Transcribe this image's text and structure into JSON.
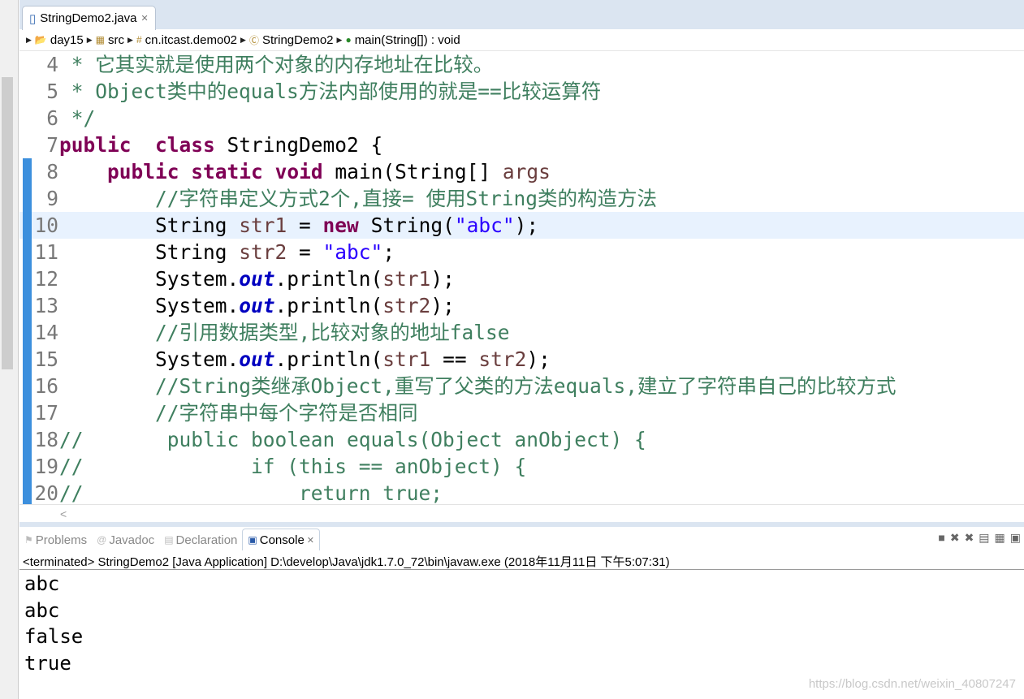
{
  "editor_tab": {
    "title": "StringDemo2.java",
    "close": "✕"
  },
  "breadcrumb": [
    "day15",
    "src",
    "cn.itcast.demo02",
    "StringDemo2",
    "main(String[]) : void"
  ],
  "code_lines": [
    {
      "n": "4",
      "parts": [
        [
          "cm",
          " * 它其实就是使用两个对象的内存地址在比较。"
        ]
      ]
    },
    {
      "n": "5",
      "parts": [
        [
          "cm",
          " * Object类中的equals方法内部使用的就是==比较运算符"
        ]
      ]
    },
    {
      "n": "6",
      "parts": [
        [
          "cm",
          " */"
        ]
      ]
    },
    {
      "n": "7",
      "parts": [
        [
          "kw",
          "public"
        ],
        [
          "",
          "  "
        ],
        [
          "kw",
          "class"
        ],
        [
          "",
          " StringDemo2 {"
        ]
      ]
    },
    {
      "n": "8",
      "parts": [
        [
          "",
          "    "
        ],
        [
          "kw",
          "public"
        ],
        [
          "",
          " "
        ],
        [
          "kw",
          "static"
        ],
        [
          "",
          " "
        ],
        [
          "kw",
          "void"
        ],
        [
          "",
          " main(String[] "
        ],
        [
          "vr",
          "args"
        ],
        [
          ") {"
        ]
      ]
    },
    {
      "n": "9",
      "parts": [
        [
          "",
          "        "
        ],
        [
          "cm",
          "//字符串定义方式2个,直接= 使用String类的构造方法"
        ]
      ]
    },
    {
      "n": "10",
      "parts": [
        [
          "",
          "        String "
        ],
        [
          "vr",
          "str1"
        ],
        [
          "",
          " = "
        ],
        [
          "kw",
          "new"
        ],
        [
          "",
          " String("
        ],
        [
          "st",
          "\"abc\""
        ],
        [
          "",
          ");"
        ]
      ]
    },
    {
      "n": "11",
      "parts": [
        [
          "",
          "        String "
        ],
        [
          "vr",
          "str2"
        ],
        [
          "",
          " = "
        ],
        [
          "st",
          "\"abc\""
        ],
        [
          "",
          ";"
        ]
      ]
    },
    {
      "n": "12",
      "parts": [
        [
          "",
          "        System."
        ],
        [
          "fd",
          "out"
        ],
        [
          "",
          ".println("
        ],
        [
          "vr",
          "str1"
        ],
        [
          "",
          ");"
        ]
      ]
    },
    {
      "n": "13",
      "parts": [
        [
          "",
          "        System."
        ],
        [
          "fd",
          "out"
        ],
        [
          "",
          ".println("
        ],
        [
          "vr",
          "str2"
        ],
        [
          "",
          ");"
        ]
      ]
    },
    {
      "n": "14",
      "parts": [
        [
          "",
          "        "
        ],
        [
          "cm",
          "//引用数据类型,比较对象的地址false"
        ]
      ]
    },
    {
      "n": "15",
      "parts": [
        [
          "",
          "        System."
        ],
        [
          "fd",
          "out"
        ],
        [
          "",
          ".println("
        ],
        [
          "vr",
          "str1"
        ],
        [
          "",
          " == "
        ],
        [
          "vr",
          "str2"
        ],
        [
          "",
          ");"
        ]
      ]
    },
    {
      "n": "16",
      "parts": [
        [
          "",
          "        "
        ],
        [
          "cm",
          "//String类继承Object,重写了父类的方法equals,建立了字符串自己的比较方式"
        ]
      ]
    },
    {
      "n": "17",
      "parts": [
        [
          "",
          "        "
        ],
        [
          "cm",
          "//字符串中每个字符是否相同"
        ]
      ]
    },
    {
      "n": "18",
      "parts": [
        [
          "cm",
          "//       public boolean equals(Object anObject) {"
        ]
      ]
    },
    {
      "n": "19",
      "parts": [
        [
          "cm",
          "//              if (this == anObject) {"
        ]
      ]
    },
    {
      "n": "20",
      "parts": [
        [
          "cm",
          "//                  return true;"
        ]
      ]
    }
  ],
  "current_line": "10",
  "console": {
    "tabs": [
      "Problems",
      "Javadoc",
      "Declaration",
      "Console"
    ],
    "active": "Console",
    "status": "<terminated> StringDemo2 [Java Application] D:\\develop\\Java\\jdk1.7.0_72\\bin\\javaw.exe (2018年11月11日 下午5:07:31)",
    "output": [
      "abc",
      "abc",
      "false",
      "true"
    ]
  },
  "watermark": "https://blog.csdn.net/weixin_40807247"
}
